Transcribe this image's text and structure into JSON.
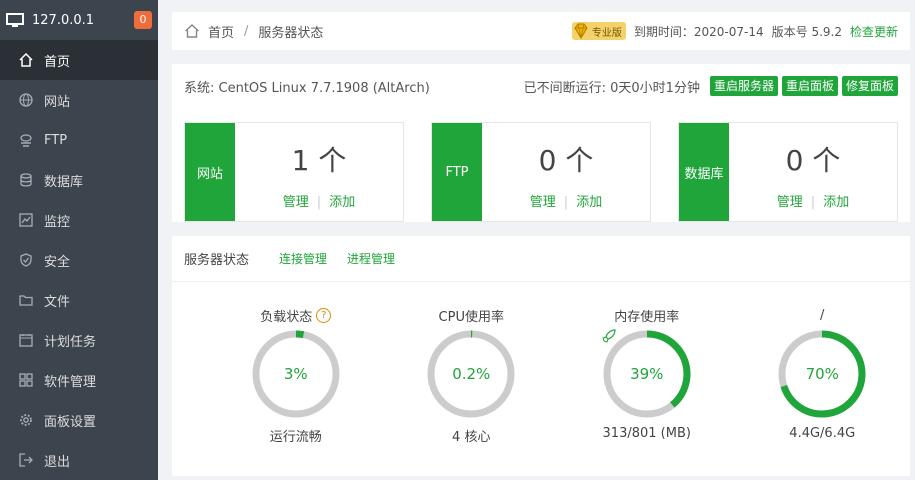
{
  "sidebar": {
    "host": "127.0.0.1",
    "badge": "0",
    "items": [
      {
        "label": "首页",
        "icon": "home-icon"
      },
      {
        "label": "网站",
        "icon": "globe-icon"
      },
      {
        "label": "FTP",
        "icon": "ftp-icon"
      },
      {
        "label": "数据库",
        "icon": "database-icon"
      },
      {
        "label": "监控",
        "icon": "monitor-icon"
      },
      {
        "label": "安全",
        "icon": "shield-icon"
      },
      {
        "label": "文件",
        "icon": "folder-icon"
      },
      {
        "label": "计划任务",
        "icon": "calendar-icon"
      },
      {
        "label": "软件管理",
        "icon": "grid-icon"
      },
      {
        "label": "面板设置",
        "icon": "gear-icon"
      },
      {
        "label": "退出",
        "icon": "logout-icon"
      }
    ]
  },
  "breadcrumb": {
    "home": "首页",
    "sep": "/",
    "current": "服务器状态"
  },
  "topbar": {
    "edition": "专业版",
    "expiry": "到期时间：2020-07-14",
    "version": "版本号 5.9.2",
    "check_update": "检查更新"
  },
  "system": {
    "os": "系统: CentOS Linux 7.7.1908 (AltArch)",
    "uptime": "已不间断运行: 0天0小时1分钟",
    "buttons": [
      "重启服务器",
      "重启面板",
      "修复面板"
    ]
  },
  "stats": [
    {
      "tag": "网站",
      "count": "1 个",
      "manage": "管理",
      "add": "添加"
    },
    {
      "tag": "FTP",
      "count": "0 个",
      "manage": "管理",
      "add": "添加"
    },
    {
      "tag": "数据库",
      "count": "0 个",
      "manage": "管理",
      "add": "添加"
    }
  ],
  "status": {
    "title": "服务器状态",
    "tabs": [
      "连接管理",
      "进程管理"
    ],
    "gauges": [
      {
        "title": "负载状态",
        "value": "3%",
        "percent": 3,
        "sub": "运行流畅",
        "help": "?"
      },
      {
        "title": "CPU使用率",
        "value": "0.2%",
        "percent": 0.2,
        "sub": "4 核心"
      },
      {
        "title": "内存使用率",
        "value": "39%",
        "percent": 39,
        "sub": "313/801 (MB)"
      },
      {
        "title": "/",
        "value": "70%",
        "percent": 70,
        "sub": "4.4G/6.4G"
      }
    ]
  },
  "colors": {
    "accent": "#20a53a",
    "sidebar": "#3c444d",
    "badge": "#f16c3b",
    "ring_track": "#cccccc"
  }
}
